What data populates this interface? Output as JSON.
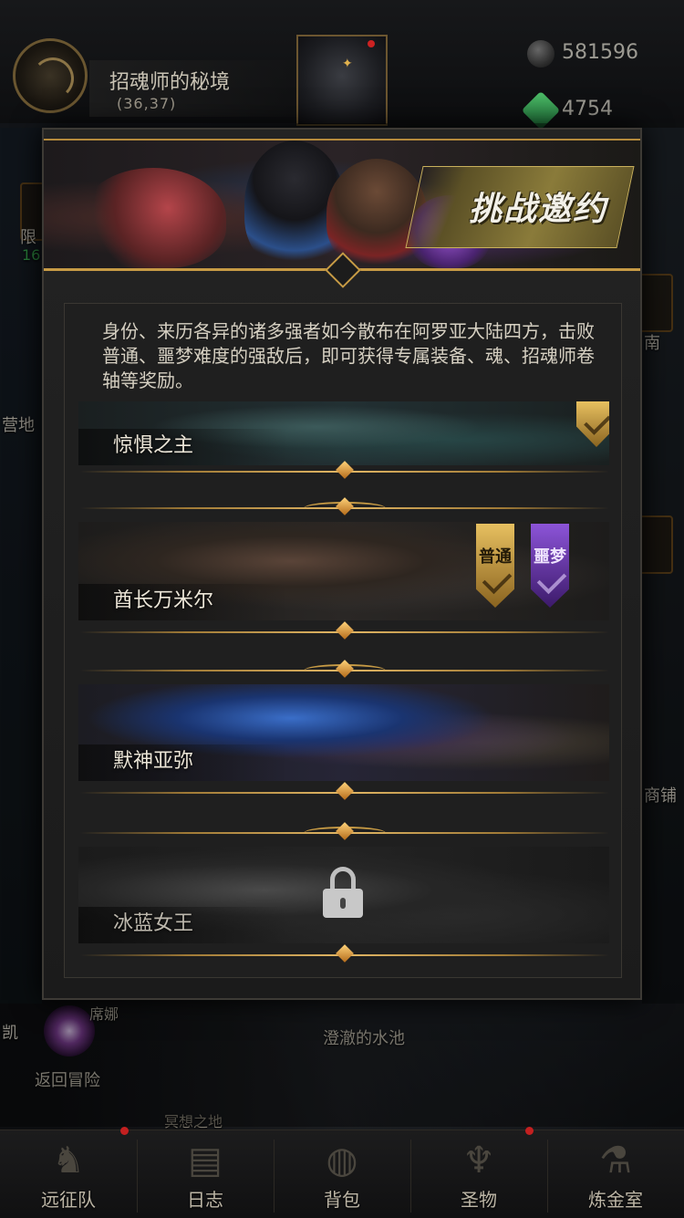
{
  "location": {
    "name": "招魂师的秘境",
    "coords": "(36,37)"
  },
  "resources": [
    {
      "icon": "stone-icon",
      "value": "581596"
    },
    {
      "icon": "gem-icon",
      "value": "4754"
    }
  ],
  "side_labels": {
    "left_1": "限",
    "left_1_sub": "16",
    "left_2": "营地",
    "right_1": "南",
    "right_2": "商铺",
    "left_3": "凯"
  },
  "map_labels": {
    "char_name": "席娜",
    "return": "返回冒险",
    "pool": "澄澈的水池",
    "bottom": "冥想之地"
  },
  "modal": {
    "banner_title": "挑战邀约",
    "description": "身份、来历各异的诸多强者如今散布在阿罗亚大陆四方，击败普通、噩梦难度的强敌后，即可获得专属装备、魂、招魂师卷轴等奖励。",
    "bosses": [
      {
        "name": "惊惧之主",
        "theme": "teal",
        "status": "completed"
      },
      {
        "name": "酋长万米尔",
        "theme": "brown",
        "status": "difficulty",
        "badges": [
          "普通",
          "噩梦"
        ]
      },
      {
        "name": "默神亚弥",
        "theme": "blue",
        "status": "open"
      },
      {
        "name": "冰蓝女王",
        "theme": "gray",
        "status": "locked"
      }
    ]
  },
  "nav": [
    {
      "label": "远征队",
      "icon": "horned-helmet-icon",
      "badge": true
    },
    {
      "label": "日志",
      "icon": "scroll-icon",
      "badge": false
    },
    {
      "label": "背包",
      "icon": "bag-icon",
      "badge": false
    },
    {
      "label": "圣物",
      "icon": "chalice-icon",
      "badge": true
    },
    {
      "label": "炼金室",
      "icon": "alchemy-icon",
      "badge": false
    }
  ],
  "colors": {
    "accent_gold": "#c79b45",
    "nightmare_purple": "#8c54d8",
    "badge_red": "#c32020"
  }
}
